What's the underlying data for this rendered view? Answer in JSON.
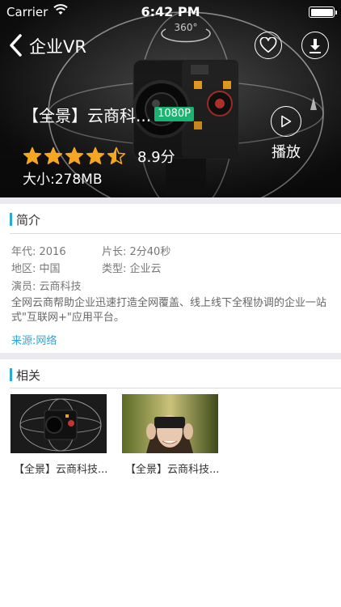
{
  "status_bar": {
    "carrier": "Carrier",
    "time": "6:42 PM"
  },
  "nav": {
    "title": "企业VR"
  },
  "hero": {
    "title": "【全景】云商科...",
    "quality_badge": "1080P",
    "rating": 4.5,
    "rating_max": 5,
    "score": "8.9分",
    "size": "大小:278MB",
    "play_label": "播放"
  },
  "intro": {
    "heading": "简介",
    "year": "年代: 2016",
    "duration": "片长: 2分40秒",
    "region": "地区: 中国",
    "genre": "类型: 企业云",
    "cast": "演员: 云商科技",
    "description": "全网云商帮助企业迅速打造全网覆盖、线上线下全程协调的企业一站式\"互联网+\"应用平台。",
    "source": "来源:网络"
  },
  "related": {
    "heading": "相关",
    "items": [
      {
        "caption": "【全景】云商科技...",
        "image": "360-camera-thumbnail"
      },
      {
        "caption": "【全景】云商科技...",
        "image": "woman-vr-headset-thumbnail"
      }
    ]
  },
  "colors": {
    "accent": "#29a8e0",
    "star": "#f5a623",
    "badge": "#1ab36f"
  }
}
